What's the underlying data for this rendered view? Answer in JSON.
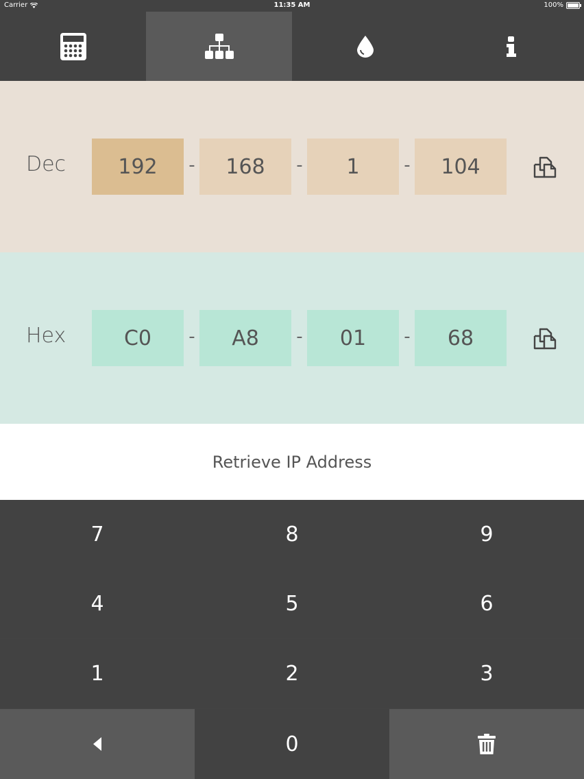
{
  "status_bar": {
    "carrier": "Carrier",
    "time": "11:35 AM",
    "battery": "100%"
  },
  "tabs": [
    {
      "icon": "calculator-icon",
      "active": false
    },
    {
      "icon": "network-icon",
      "active": true
    },
    {
      "icon": "droplet-icon",
      "active": false
    },
    {
      "icon": "info-icon",
      "active": false
    }
  ],
  "dec": {
    "label": "Dec",
    "octets": [
      "192",
      "168",
      "1",
      "104"
    ],
    "separator": "-",
    "selected_index": 0
  },
  "hex": {
    "label": "Hex",
    "octets": [
      "C0",
      "A8",
      "01",
      "68"
    ],
    "separator": "-"
  },
  "retrieve_label": "Retrieve IP Address",
  "keypad": {
    "k7": "7",
    "k8": "8",
    "k9": "9",
    "k4": "4",
    "k5": "5",
    "k6": "6",
    "k1": "1",
    "k2": "2",
    "k3": "3",
    "k0": "0",
    "back_icon": "triangle-left-icon",
    "clear_icon": "trash-icon"
  },
  "colors": {
    "dec_bg": "#e9e0d6",
    "dec_octet": "#e6d2b9",
    "dec_octet_selected": "#dbbd91",
    "hex_bg": "#d5e9e3",
    "hex_octet": "#b8e6d6",
    "dark": "#424242",
    "dark_alt": "#5a5a5a"
  }
}
